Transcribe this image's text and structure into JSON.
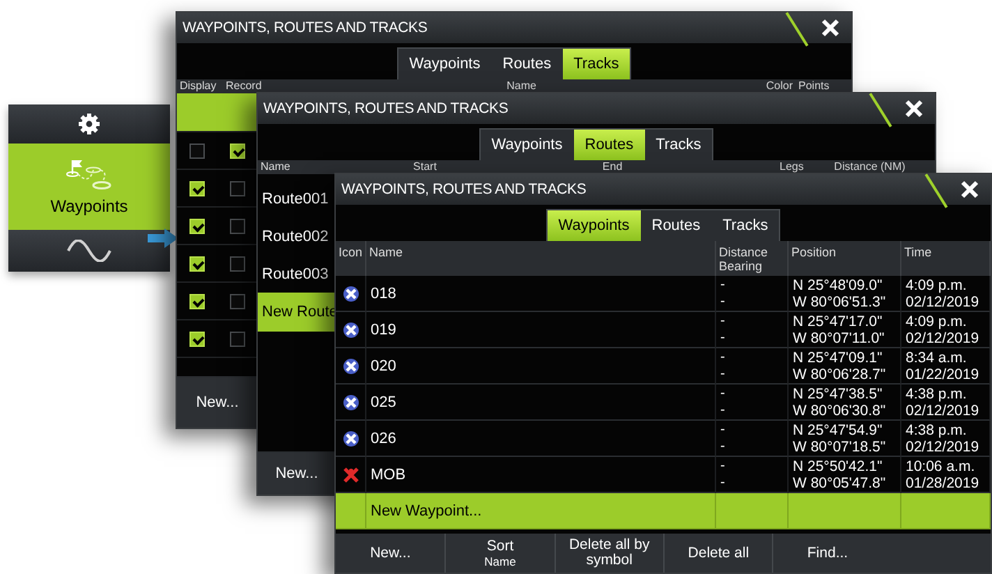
{
  "side_menu": {
    "items": [
      {
        "kind": "settings",
        "selected": false
      },
      {
        "kind": "waypoints",
        "label": "Waypoints",
        "selected": true
      },
      {
        "kind": "wave",
        "selected": false
      }
    ]
  },
  "windows": [
    {
      "kind": "tracks",
      "title": "WAYPOINTS, ROUTES AND TRACKS",
      "tabs": [
        {
          "label": "Waypoints",
          "selected": false
        },
        {
          "label": "Routes",
          "selected": false
        },
        {
          "label": "Tracks",
          "selected": true
        }
      ],
      "columns": [
        "Display",
        "Record",
        "Name",
        "Color",
        "Points"
      ],
      "rows": [
        {
          "selected": true
        },
        {
          "selected": false,
          "display": false,
          "record": true
        },
        {
          "selected": false,
          "display": true,
          "record": false
        },
        {
          "selected": false,
          "display": true,
          "record": false
        },
        {
          "selected": false,
          "display": true,
          "record": false
        },
        {
          "selected": false,
          "display": true,
          "record": false
        },
        {
          "selected": false,
          "display": true,
          "record": false
        }
      ],
      "footer_buttons": [
        {
          "label": "New..."
        }
      ]
    },
    {
      "kind": "routes",
      "title": "WAYPOINTS, ROUTES AND TRACKS",
      "tabs": [
        {
          "label": "Waypoints",
          "selected": false
        },
        {
          "label": "Routes",
          "selected": true
        },
        {
          "label": "Tracks",
          "selected": false
        }
      ],
      "columns": [
        "Name",
        "Start",
        "End",
        "Legs",
        "Distance (NM)"
      ],
      "rows": [
        {
          "name": "Route001",
          "selected": false
        },
        {
          "name": "Route002",
          "selected": false
        },
        {
          "name": "Route003",
          "selected": false
        },
        {
          "name": "New Route",
          "selected": true
        }
      ],
      "footer_buttons": [
        {
          "label": "New..."
        }
      ]
    },
    {
      "kind": "waypoints",
      "title": "WAYPOINTS, ROUTES AND TRACKS",
      "tabs": [
        {
          "label": "Waypoints",
          "selected": true
        },
        {
          "label": "Routes",
          "selected": false
        },
        {
          "label": "Tracks",
          "selected": false
        }
      ],
      "columns": [
        "Icon",
        "Name",
        "Distance\nBearing",
        "Position",
        "Time"
      ],
      "rows": [
        {
          "kind": "waypoint",
          "name": "018",
          "distance": "-",
          "bearing": "-",
          "latitude": "N 25°48'09.0\"",
          "longitude": "W 80°06'51.3\"",
          "time": "4:09 p.m.",
          "date": "02/12/2019",
          "selected": false
        },
        {
          "kind": "waypoint",
          "name": "019",
          "distance": "-",
          "bearing": "-",
          "latitude": "N 25°47'17.0\"",
          "longitude": "W 80°07'11.0\"",
          "time": "4:09 p.m.",
          "date": "02/12/2019",
          "selected": false
        },
        {
          "kind": "waypoint",
          "name": "020",
          "distance": "-",
          "bearing": "-",
          "latitude": "N 25°47'09.1\"",
          "longitude": "W 80°06'28.7\"",
          "time": "8:34 a.m.",
          "date": "01/22/2019",
          "selected": false
        },
        {
          "kind": "waypoint",
          "name": "025",
          "distance": "-",
          "bearing": "-",
          "latitude": "N 25°47'38.5\"",
          "longitude": "W 80°06'30.8\"",
          "time": "4:38 p.m.",
          "date": "02/12/2019",
          "selected": false
        },
        {
          "kind": "waypoint",
          "name": "026",
          "distance": "-",
          "bearing": "-",
          "latitude": "N 25°47'54.9\"",
          "longitude": "W 80°07'18.5\"",
          "time": "4:38 p.m.",
          "date": "02/12/2019",
          "selected": false
        },
        {
          "kind": "mob",
          "name": "MOB",
          "distance": "-",
          "bearing": "-",
          "latitude": "N 25°50'42.1\"",
          "longitude": "W 80°05'47.8\"",
          "time": "10:06 a.m.",
          "date": "01/28/2019",
          "selected": false
        },
        {
          "kind": "new",
          "name": "New Waypoint...",
          "selected": true
        }
      ],
      "footer_buttons": [
        {
          "label": "New..."
        },
        {
          "label": "Sort",
          "value": "Name"
        },
        {
          "label": "Delete all by symbol"
        },
        {
          "label": "Delete all"
        },
        {
          "label": "Find..."
        }
      ]
    }
  ]
}
